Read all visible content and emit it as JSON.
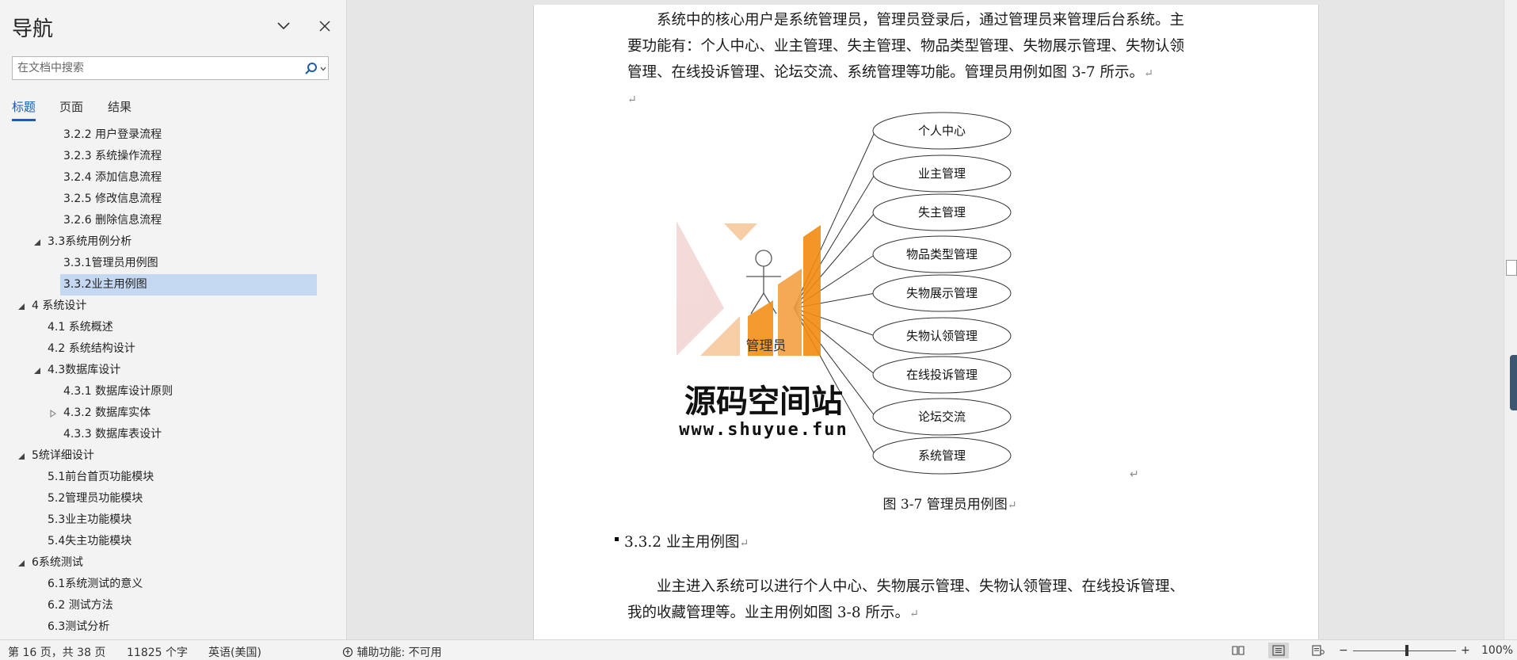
{
  "nav": {
    "title": "导航",
    "search_placeholder": "在文档中搜索",
    "tabs": [
      {
        "label": "标题",
        "active": true
      },
      {
        "label": "页面",
        "active": false
      },
      {
        "label": "结果",
        "active": false
      }
    ],
    "outline": [
      {
        "label": "3.2.2 用户登录流程",
        "level": 3,
        "toggle": "none"
      },
      {
        "label": "3.2.3 系统操作流程",
        "level": 3,
        "toggle": "none"
      },
      {
        "label": "3.2.4 添加信息流程",
        "level": 3,
        "toggle": "none"
      },
      {
        "label": "3.2.5 修改信息流程",
        "level": 3,
        "toggle": "none"
      },
      {
        "label": "3.2.6 删除信息流程",
        "level": 3,
        "toggle": "none"
      },
      {
        "label": "3.3系统用例分析",
        "level": 2,
        "toggle": "expanded"
      },
      {
        "label": "3.3.1管理员用例图",
        "level": 3,
        "toggle": "none"
      },
      {
        "label": "3.3.2业主用例图",
        "level": 3,
        "toggle": "none",
        "selected": true
      },
      {
        "label": "4 系统设计",
        "level": 1,
        "toggle": "expanded"
      },
      {
        "label": "4.1 系统概述",
        "level": 2,
        "toggle": "none"
      },
      {
        "label": "4.2 系统结构设计",
        "level": 2,
        "toggle": "none"
      },
      {
        "label": "4.3数据库设计",
        "level": 2,
        "toggle": "expanded"
      },
      {
        "label": "4.3.1 数据库设计原则",
        "level": 3,
        "toggle": "none"
      },
      {
        "label": "4.3.2 数据库实体",
        "level": 3,
        "toggle": "collapsed"
      },
      {
        "label": "4.3.3 数据库表设计",
        "level": 3,
        "toggle": "none"
      },
      {
        "label": "5统详细设计",
        "level": 1,
        "toggle": "expanded"
      },
      {
        "label": "5.1前台首页功能模块",
        "level": 2,
        "toggle": "none"
      },
      {
        "label": "5.2管理员功能模块",
        "level": 2,
        "toggle": "none"
      },
      {
        "label": "5.3业主功能模块",
        "level": 2,
        "toggle": "none"
      },
      {
        "label": "5.4失主功能模块",
        "level": 2,
        "toggle": "none"
      },
      {
        "label": "6系统测试",
        "level": 1,
        "toggle": "expanded"
      },
      {
        "label": "6.1系统测试的意义",
        "level": 2,
        "toggle": "none"
      },
      {
        "label": "6.2 测试方法",
        "level": 2,
        "toggle": "none"
      },
      {
        "label": "6.3测试分析",
        "level": 2,
        "toggle": "none"
      }
    ]
  },
  "document": {
    "para1_lines": [
      "　　系统中的核心用户是系统管理员，管理员登录后，通过管理员来管理后台系统。主",
      "要功能有：个人中心、业主管理、失主管理、物品类型管理、失物展示管理、失物认领",
      "管理、在线投诉管理、论坛交流、系统管理等功能。管理员用例如图 3-7 所示。"
    ],
    "paragraph_mark": "↵",
    "diagram": {
      "actor": "管理员",
      "use_cases": [
        "个人中心",
        "业主管理",
        "失主管理",
        "物品类型管理",
        "失物展示管理",
        "失物认领管理",
        "在线投诉管理",
        "论坛交流",
        "系统管理"
      ]
    },
    "watermark": {
      "title": "源码空间站",
      "url": "www.shuyue.fun",
      "colors": {
        "orange": "#f39019",
        "light_orange": "#f6c89b",
        "pink": "#f2d7d5"
      }
    },
    "caption": "图 3-7  管理员用例图",
    "heading": "3.3.2 业主用例图",
    "para2_lines": [
      "　　业主进入系统可以进行个人中心、失物展示管理、失物认领管理、在线投诉管理、",
      "我的收藏管理等。业主用例如图 3-8 所示。"
    ]
  },
  "status": {
    "page_info": "第 16 页，共 38 页",
    "word_count": "11825 个字",
    "language": "英语(美国)",
    "accessibility": "辅助功能: 不可用",
    "zoom": "100%",
    "zoom_minus": "−",
    "zoom_plus": "+"
  },
  "colors": {
    "accent": "#1f5da8",
    "selection": "#c5d8f2",
    "nav_bg": "#f3f3f3",
    "canvas_bg": "#e6e6e6"
  }
}
